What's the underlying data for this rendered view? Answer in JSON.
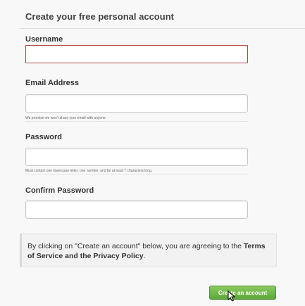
{
  "form": {
    "title": "Create your free personal account",
    "username": {
      "label": "Username",
      "value": "",
      "placeholder": ""
    },
    "email": {
      "label": "Email Address",
      "value": "",
      "placeholder": "",
      "hint": "We promise we won't share your email with anyone."
    },
    "password": {
      "label": "Password",
      "value": "",
      "placeholder": "",
      "hint": "Must contain one lowercase letter, one number, and be at least 7 characters long."
    },
    "confirm_password": {
      "label": "Confirm Password",
      "value": "",
      "placeholder": ""
    },
    "terms": {
      "text_before": "By clicking on \"Create an account\" below, you are agreeing to the ",
      "link_text": "Terms of Service and the Privacy Policy",
      "text_after": "."
    },
    "submit_label": "Create an account"
  },
  "colors": {
    "error_border": "#b44444",
    "button_green": "#6db544",
    "background": "#f8f8f8"
  },
  "icons": {
    "cursor": "mouse-pointer-icon"
  }
}
